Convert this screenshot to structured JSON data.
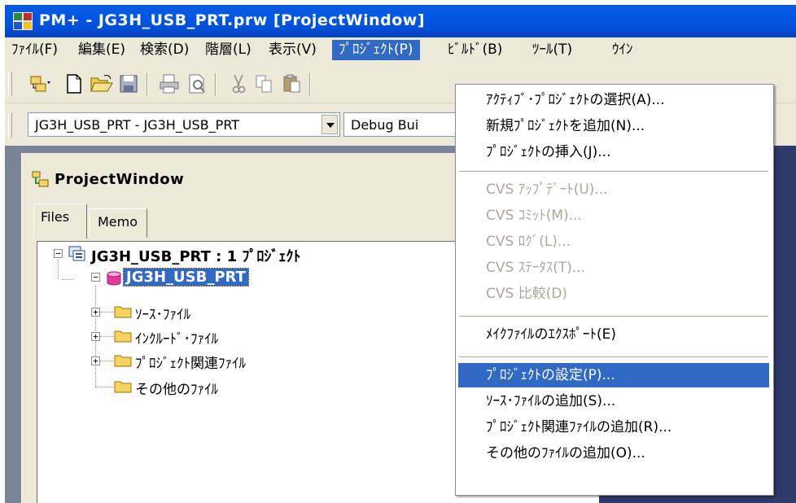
{
  "window": {
    "title": "PM+ - JG3H_USB_PRT.prw [ProjectWindow]"
  },
  "menubar": [
    {
      "label": "ﾌｧｲﾙ(F)"
    },
    {
      "label": "編集(E)"
    },
    {
      "label": "検索(D)"
    },
    {
      "label": "階層(L)"
    },
    {
      "label": "表示(V)"
    },
    {
      "label": "ﾌﾟﾛｼﾞｪｸﾄ(P)"
    },
    {
      "label": "ﾋﾞﾙﾄﾞ(B)"
    },
    {
      "label": "ﾂｰﾙ(T)"
    },
    {
      "label": "ｳｲﾝ"
    }
  ],
  "toolbar": {
    "project_combo": "JG3H_USB_PRT - JG3H_USB_PRT",
    "build_combo": "Debug Bui"
  },
  "project_window": {
    "title": "ProjectWindow",
    "tabs": [
      "Files",
      "Memo"
    ],
    "tree": {
      "root": "JG3H_USB_PRT : 1 ﾌﾟﾛｼﾞｪｸﾄ",
      "project": "JG3H_USB_PRT",
      "folders": [
        "ｿｰｽ･ﾌｧｲﾙ",
        "ｲﾝｸﾙｰﾄﾞ･ﾌｧｲﾙ",
        "ﾌﾟﾛｼﾞｪｸﾄ関連ﾌｧｲﾙ",
        "その他のﾌｧｲﾙ"
      ]
    }
  },
  "project_menu": {
    "items": [
      {
        "label": "ｱｸﾃｨﾌﾞ･ﾌﾟﾛｼﾞｪｸﾄの選択(A)...",
        "enabled": true
      },
      {
        "label": "新規ﾌﾟﾛｼﾞｪｸﾄを追加(N)...",
        "enabled": true
      },
      {
        "label": "ﾌﾟﾛｼﾞｪｸﾄの挿入(J)...",
        "enabled": true
      },
      {
        "label": "CVS ｱｯﾌﾟﾃﾞｰﾄ(U)...",
        "enabled": false
      },
      {
        "label": "CVS ｺﾐｯﾄ(M)...",
        "enabled": false
      },
      {
        "label": "CVS ﾛｸﾞ(L)...",
        "enabled": false
      },
      {
        "label": "CVS ｽﾃｰﾀｽ(T)...",
        "enabled": false
      },
      {
        "label": "CVS 比較(D)",
        "enabled": false
      },
      {
        "label": "ﾒｲｸﾌｧｲﾙのｴｸｽﾎﾟｰﾄ(E)",
        "enabled": true
      },
      {
        "label": "ﾌﾟﾛｼﾞｪｸﾄの設定(P)...",
        "enabled": true,
        "highlighted": true
      },
      {
        "label": "ｿｰｽ･ﾌｧｲﾙの追加(S)...",
        "enabled": true
      },
      {
        "label": "ﾌﾟﾛｼﾞｪｸﾄ関連ﾌｧｲﾙの追加(R)...",
        "enabled": true
      },
      {
        "label": "その他のﾌｧｲﾙの追加(O)...",
        "enabled": true
      }
    ]
  },
  "colors": {
    "title_bar": "#0058e6",
    "highlight": "#316ac5",
    "face": "#ece9d8",
    "disabled_text": "#aca899"
  },
  "icons": [
    "app-icon",
    "project-window-icon",
    "open-menu-icon",
    "new-file-icon",
    "open-folder-icon",
    "save-icon",
    "print-icon",
    "print-preview-icon",
    "cut-icon",
    "copy-icon",
    "paste-icon",
    "project-group-icon",
    "project-icon",
    "folder-icon"
  ]
}
